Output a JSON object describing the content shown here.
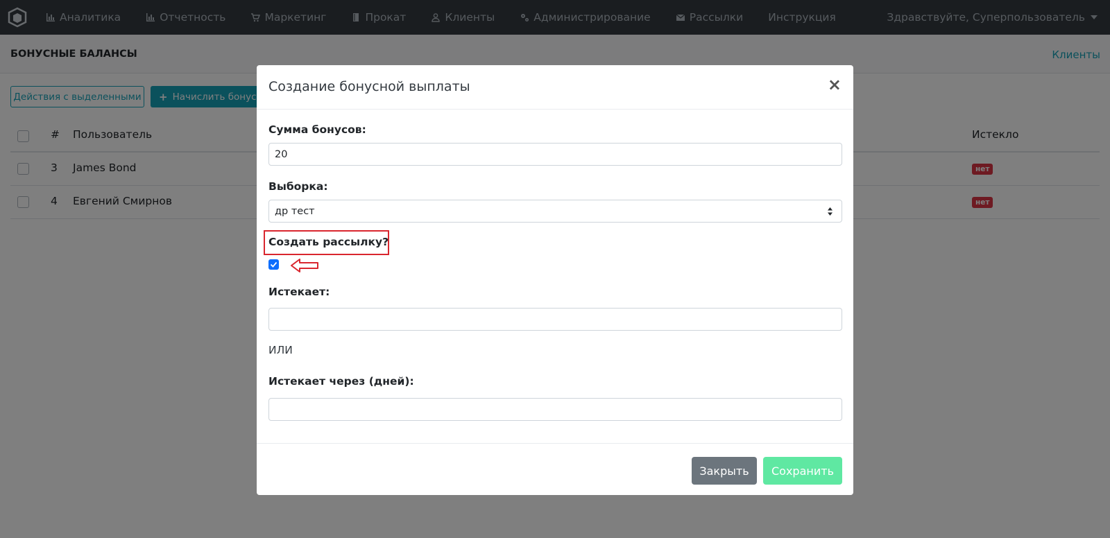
{
  "navbar": {
    "items": [
      {
        "label": "Аналитика",
        "icon": "bar-chart-icon"
      },
      {
        "label": "Отчетность",
        "icon": "bar-chart-icon"
      },
      {
        "label": "Маркетинг",
        "icon": "cart-icon"
      },
      {
        "label": "Прокат",
        "icon": "book-icon"
      },
      {
        "label": "Клиенты",
        "icon": "user-icon"
      },
      {
        "label": "Администрирование",
        "icon": "gears-icon"
      },
      {
        "label": "Рассылки",
        "icon": "envelope-icon"
      },
      {
        "label": "Инструкция",
        "icon": ""
      }
    ],
    "user_greeting": "Здравствуйте, Суперпользователь"
  },
  "page": {
    "title": "БОНУСНЫЕ БАЛАНСЫ",
    "breadcrumb_link": "Клиенты"
  },
  "toolbar": {
    "bulk_actions_label": "Действия с выделенными",
    "add_bonus_label": "Начислить бонусы"
  },
  "table": {
    "columns": {
      "num": "#",
      "user": "Пользователь",
      "expired": "Истекло"
    },
    "rows": [
      {
        "num": "3",
        "user": "James Bond",
        "expired": "нет"
      },
      {
        "num": "4",
        "user": "Евгений Смирнов",
        "expired": "нет"
      }
    ]
  },
  "modal": {
    "title": "Создание бонусной выплаты",
    "close_symbol": "×",
    "fields": {
      "amount_label": "Сумма бонусов:",
      "amount_value": "20",
      "selection_label": "Выборка:",
      "selection_value": "др тест",
      "create_mailing_label": "Создать рассылку?",
      "create_mailing_checked": true,
      "expires_label": "Истекает:",
      "expires_value": "",
      "or_text": "ИЛИ",
      "expires_days_label": "Истекает через (дней):",
      "expires_days_value": ""
    },
    "footer": {
      "close_label": "Закрыть",
      "save_label": "Сохранить"
    }
  },
  "colors": {
    "navbar_bg": "#343a40",
    "info": "#17a2b8",
    "danger": "#dc3545",
    "annotation": "#d9262e",
    "save_button": "#5fe8a2",
    "close_button": "#6c757d"
  }
}
